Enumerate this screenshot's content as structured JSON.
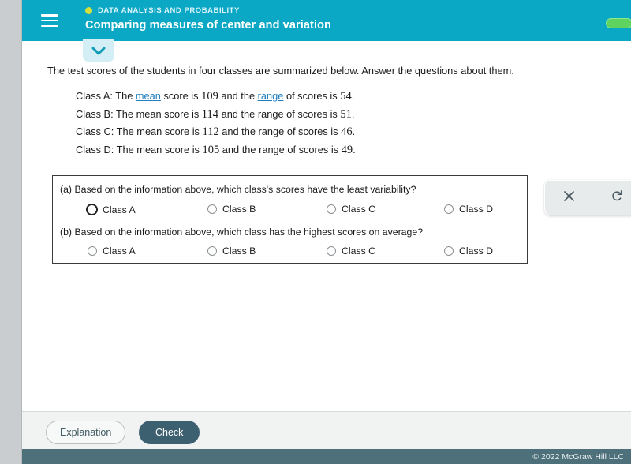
{
  "header": {
    "menu_icon": "hamburger-menu-icon",
    "kicker_dot": "status-dot-icon",
    "kicker": "DATA ANALYSIS AND PROBABILITY",
    "title": "Comparing measures of center and variation",
    "toggle_pill": "green-toggle-pill",
    "colors": {
      "bar": "#0aa8c4",
      "kicker_dot": "#d6e03a",
      "pill": "#5fd35f"
    }
  },
  "collapse_tab": {
    "icon": "chevron-down-icon",
    "color": "#0f9ab5"
  },
  "content": {
    "intro": "The test scores of the students in four classes are summarized below. Answer the questions about them.",
    "class_lines": [
      {
        "prefix": "Class A: The ",
        "link1": "mean",
        "mid1": " score is ",
        "value1": "109",
        "mid2": " and the ",
        "link2": "range",
        "mid3": " of scores is ",
        "value2": "54",
        "suffix": "."
      },
      {
        "prefix": "Class B: The ",
        "link1": "mean",
        "mid1": " score is ",
        "value1": "114",
        "mid2": " and the ",
        "link2": "range",
        "mid3": " of scores is ",
        "value2": "51",
        "suffix": "."
      },
      {
        "prefix": "Class C: The ",
        "link1": "mean",
        "mid1": " score is ",
        "value1": "112",
        "mid2": " and the ",
        "link2": "range",
        "mid3": " of scores is ",
        "value2": "46",
        "suffix": "."
      },
      {
        "prefix": "Class D: The ",
        "link1": "mean",
        "mid1": " score is ",
        "value1": "105",
        "mid2": " and the ",
        "link2": "range",
        "mid3": " of scores is ",
        "value2": "49",
        "suffix": "."
      }
    ],
    "link_color": "#1f7fbf"
  },
  "questions": {
    "a": {
      "prompt": "(a) Based on the information above, which class's scores have the least variability?",
      "options": [
        {
          "label": "Class A",
          "selected": false,
          "focused": true
        },
        {
          "label": "Class B",
          "selected": false,
          "focused": false
        },
        {
          "label": "Class C",
          "selected": false,
          "focused": false
        },
        {
          "label": "Class D",
          "selected": false,
          "focused": false
        }
      ]
    },
    "b": {
      "prompt": "(b) Based on the information above, which class has the highest scores on average?",
      "options": [
        {
          "label": "Class A",
          "selected": false,
          "focused": false
        },
        {
          "label": "Class B",
          "selected": false,
          "focused": false
        },
        {
          "label": "Class C",
          "selected": false,
          "focused": false
        },
        {
          "label": "Class D",
          "selected": false,
          "focused": false
        }
      ]
    }
  },
  "side_panel": {
    "close_icon": "close-x-icon",
    "undo_icon": "undo-refresh-icon"
  },
  "footer_bar": {
    "explanation_label": "Explanation",
    "check_label": "Check",
    "check_color": "#3d6070"
  },
  "footer": {
    "copyright": "© 2022 McGraw Hill LLC."
  }
}
